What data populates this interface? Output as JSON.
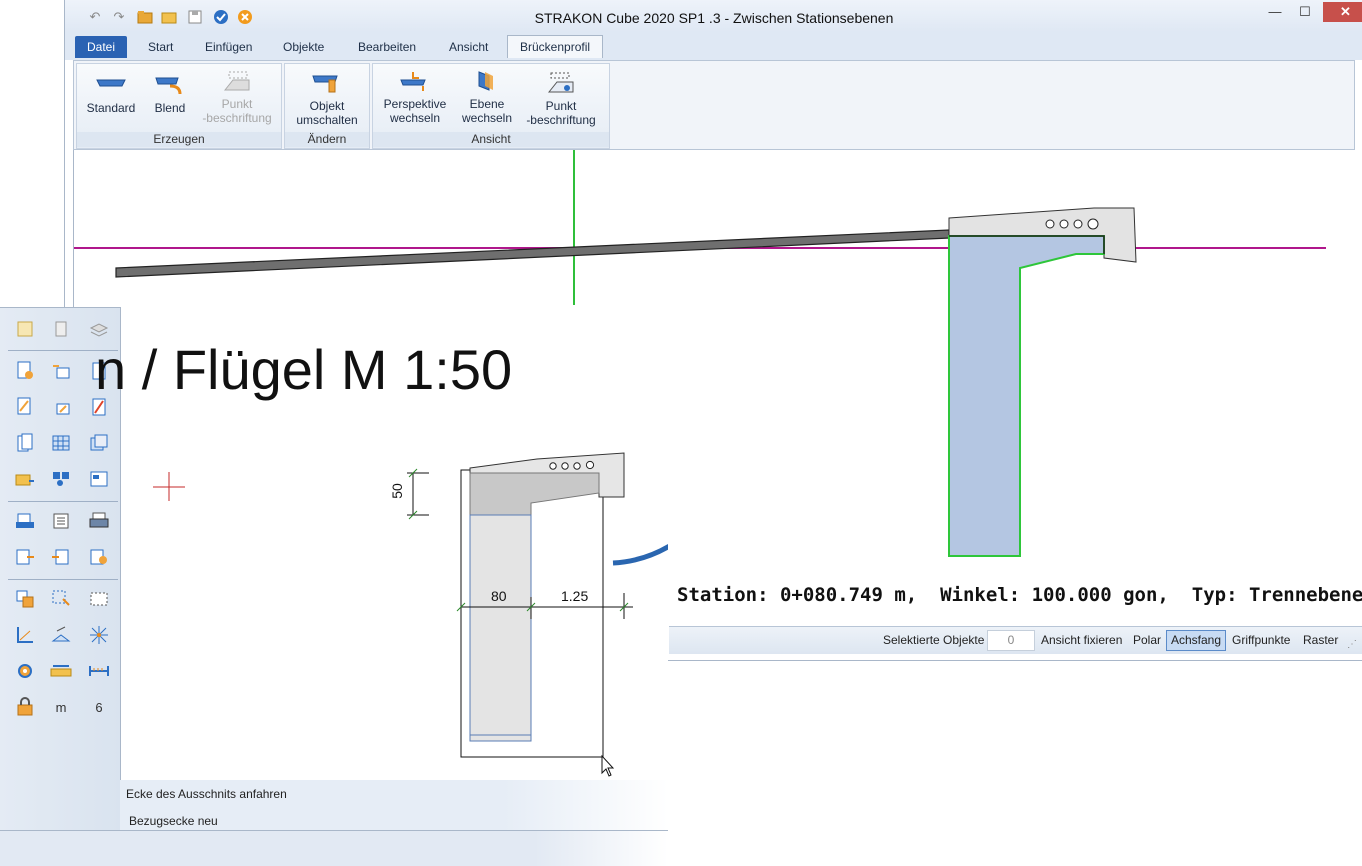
{
  "window": {
    "title": "STRAKON Cube 2020 SP1 .3 - Zwischen Stationsebenen",
    "controls": {
      "minimize": "—",
      "maximize": "☐",
      "close": "✕"
    }
  },
  "quick_access": [
    "undo-icon",
    "redo-icon",
    "open-folder-icon",
    "folder-icon",
    "save-icon",
    "check-icon",
    "cancel-icon"
  ],
  "tabs": [
    {
      "label": "Datei",
      "kind": "file"
    },
    {
      "label": "Start"
    },
    {
      "label": "Einfügen"
    },
    {
      "label": "Objekte"
    },
    {
      "label": "Bearbeiten"
    },
    {
      "label": "Ansicht"
    },
    {
      "label": "Brückenprofil",
      "active": true
    }
  ],
  "ribbon": {
    "groups": [
      {
        "label": "Erzeugen",
        "buttons": [
          {
            "label": "Standard"
          },
          {
            "label": "Blend"
          },
          {
            "label": "Punkt -beschriftung",
            "line1": "Punkt",
            "line2": "-beschriftung",
            "disabled": true
          }
        ]
      },
      {
        "label": "Ändern",
        "buttons": [
          {
            "label": "Objekt umschalten",
            "line1": "Objekt",
            "line2": "umschalten"
          }
        ]
      },
      {
        "label": "Ansicht",
        "buttons": [
          {
            "label": "Perspektive wechseln",
            "line1": "Perspektive",
            "line2": "wechseln"
          },
          {
            "label": "Ebene wechseln",
            "line1": "Ebene",
            "line2": "wechseln"
          },
          {
            "label": "Punkt -beschriftung",
            "line1": "Punkt",
            "line2": "-beschriftung"
          }
        ]
      }
    ]
  },
  "canvas": {
    "station_text": "Station: 0+080.749 m,  Winkel: 100.000 gon,  Typ: Trennebene",
    "colors": {
      "axis_green": "#2fbf3a",
      "axis_magenta": "#b0178c",
      "profile_fill": "#b4c6e2",
      "profile_outline": "#2ec63a"
    }
  },
  "statusbar": {
    "selected_label": "Selektierte Objekte",
    "selected_count": "0",
    "fix_view": "Ansicht fixieren",
    "polar": "Polar",
    "axis_snap": "Achsfang",
    "grip_points": "Griffpunkte",
    "grid": "Raster"
  },
  "secondary": {
    "drawing_title": "n / Flügel M 1:50",
    "dim_height": "50",
    "dim_left": "80",
    "dim_right": "1.25",
    "prompt_line1": "Ecke des Ausschnits anfahren",
    "prompt_line2": "Bezugsecke neu",
    "toolbar_text": {
      "m": "m",
      "six": "6"
    }
  }
}
